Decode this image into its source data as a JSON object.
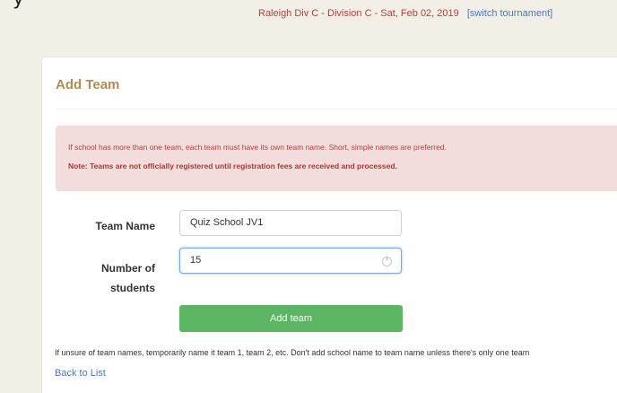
{
  "header": {
    "page_heading_fragment": "y",
    "tournament": "Raleigh Div C - Division C - Sat, Feb 02, 2019",
    "switch_link": "[switch tournament]"
  },
  "panel": {
    "title": "Add Team"
  },
  "alert": {
    "line1": "If school has more than one team, each team must have its own team name. Short, simple names are preferred.",
    "line2": "Note: Teams are not officially registered until registration fees are received and processed."
  },
  "form": {
    "team_name_label": "Team Name",
    "team_name_value": "Quiz School JV1",
    "students_label_line1": "Number of",
    "students_label_line2": "students",
    "students_value": "15",
    "submit_label": "Add team"
  },
  "footer": {
    "hint": "If unsure of team names, temporarily name it team 1, team 2, etc. Don't add school name to team name unless there's only one team",
    "back_link": "Back to List"
  },
  "colors": {
    "background": "#f2efe6",
    "title": "#b08c52",
    "alert_bg": "#f2dcdc",
    "alert_text": "#b0423c",
    "button": "#5cb562",
    "link": "#4a78b8"
  }
}
